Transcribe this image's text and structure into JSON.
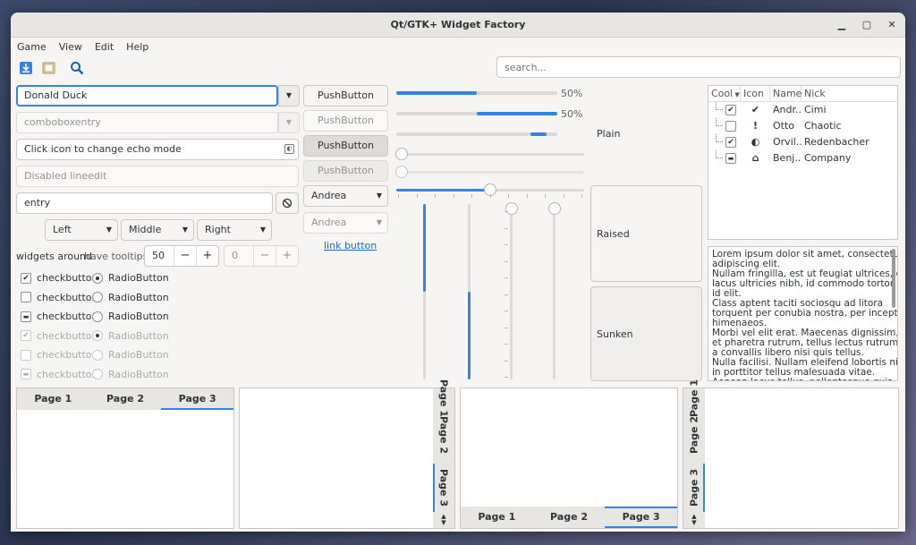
{
  "window": {
    "title": "Qt/GTK+ Widget Factory"
  },
  "menubar": [
    "Game",
    "View",
    "Edit",
    "Help"
  ],
  "toolbar": {
    "icons": [
      "download-icon",
      "folder-icon",
      "search-icon"
    ]
  },
  "search": {
    "placeholder": "search..."
  },
  "left": {
    "combo_value": "Donald Duck",
    "comboentry_placeholder": "comboboxentry",
    "echo_field": "Click icon to change echo mode",
    "disabled_lineedit": "Disabled lineedit",
    "entry": "entry",
    "align_buttons": [
      "Left",
      "Middle",
      "Right"
    ],
    "widgets_around": "widgets around",
    "have_tooltips": "have tooltips",
    "spin_value": "50",
    "spin_disabled_value": "0",
    "checks": [
      {
        "check": "checkbutton",
        "check_state": "checked",
        "radio": "RadioButton",
        "radio_on": true,
        "disabled": false
      },
      {
        "check": "checkbutton",
        "check_state": "unchecked",
        "radio": "RadioButton",
        "radio_on": false,
        "disabled": false
      },
      {
        "check": "checkbutton",
        "check_state": "mixed",
        "radio": "RadioButton",
        "radio_on": false,
        "disabled": false
      },
      {
        "check": "checkbutton",
        "check_state": "checked",
        "radio": "RadioButton",
        "radio_on": true,
        "disabled": true
      },
      {
        "check": "checkbutton",
        "check_state": "unchecked",
        "radio": "RadioButton",
        "radio_on": false,
        "disabled": true
      },
      {
        "check": "checkbutton",
        "check_state": "mixed",
        "radio": "RadioButton",
        "radio_on": false,
        "disabled": true
      }
    ]
  },
  "middle": {
    "pushbuttons": [
      "PushButton",
      "PushButton",
      "PushButton",
      "PushButton"
    ],
    "drop_active": "Andrea",
    "drop_disabled": "Andrea",
    "link_button": "link button"
  },
  "sliders": {
    "progress1_label": "50%",
    "progress1_value": 0.5,
    "progress2_label": "50%",
    "progress2_value": 0.5,
    "plain_label": "Plain",
    "slider_value": 0.5
  },
  "frames": {
    "raised": "Raised",
    "sunken": "Sunken"
  },
  "tree": {
    "columns": [
      "Cool",
      "Icon",
      "Name",
      "Nick"
    ],
    "rows": [
      {
        "cool": "checked",
        "icon": "check-circle-icon",
        "name": "Andr...",
        "nick": "Cimi"
      },
      {
        "cool": "unchecked",
        "icon": "alert-circle-icon",
        "name": "Otto",
        "nick": "Chaotic"
      },
      {
        "cool": "checked",
        "icon": "half-circle-icon",
        "name": "Orvil...",
        "nick": "Redenbacher"
      },
      {
        "cool": "mixed",
        "icon": "home-icon",
        "name": "Benj...",
        "nick": "Company"
      }
    ]
  },
  "textview": {
    "lines": [
      "Lorem ipsum dolor sit amet, consectetur",
      "adipiscing elit.",
      "Nullam fringilla, est ut feugiat ultrices, elit",
      "lacus ultricies nibh, id commodo tortor nisi",
      "id elit.",
      "Class aptent taciti sociosqu ad litora",
      "torquent per conubia nostra, per inceptos",
      "himenaeos.",
      "Morbi vel elit erat. Maecenas dignissim, dui",
      "et pharetra rutrum, tellus lectus rutrum mi,",
      "a convallis libero nisi quis tellus.",
      "Nulla facilisi. Nullam eleifend lobortis nisl,",
      "in porttitor tellus malesuada vitae.",
      "Aenean lacus tellus, pellentesque quis"
    ]
  },
  "tabs": {
    "top": [
      "Page 1",
      "Page 2",
      "Page 3"
    ],
    "right": [
      "Page 1",
      "Page 2",
      "Page 3"
    ],
    "bottom": [
      "Page 1",
      "Page 2",
      "Page 3"
    ],
    "left": [
      "Page 1",
      "Page 2",
      "Page 3"
    ],
    "active_index": 2
  }
}
